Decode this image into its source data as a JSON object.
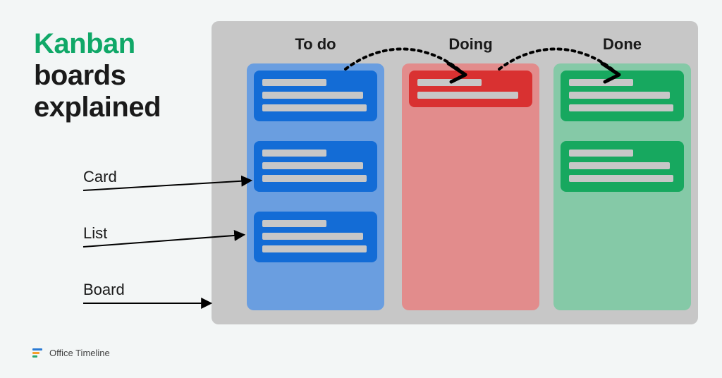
{
  "title": {
    "accent": "Kanban",
    "rest": "boards\nexplained"
  },
  "columns": {
    "todo": {
      "label": "To do",
      "card_count": 3
    },
    "doing": {
      "label": "Doing",
      "card_count": 1
    },
    "done": {
      "label": "Done",
      "card_count": 2
    }
  },
  "annotations": {
    "card": "Card",
    "list": "List",
    "board": "Board"
  },
  "brand": "Office Timeline",
  "colors": {
    "accent_green": "#10a868",
    "board_bg": "#c7c7c7",
    "col_todo": "#6a9ee0",
    "col_doing": "#e28c8c",
    "col_done": "#85c9a7",
    "card_blue": "#136cd6",
    "card_red": "#d93131",
    "card_green": "#17a85f"
  }
}
